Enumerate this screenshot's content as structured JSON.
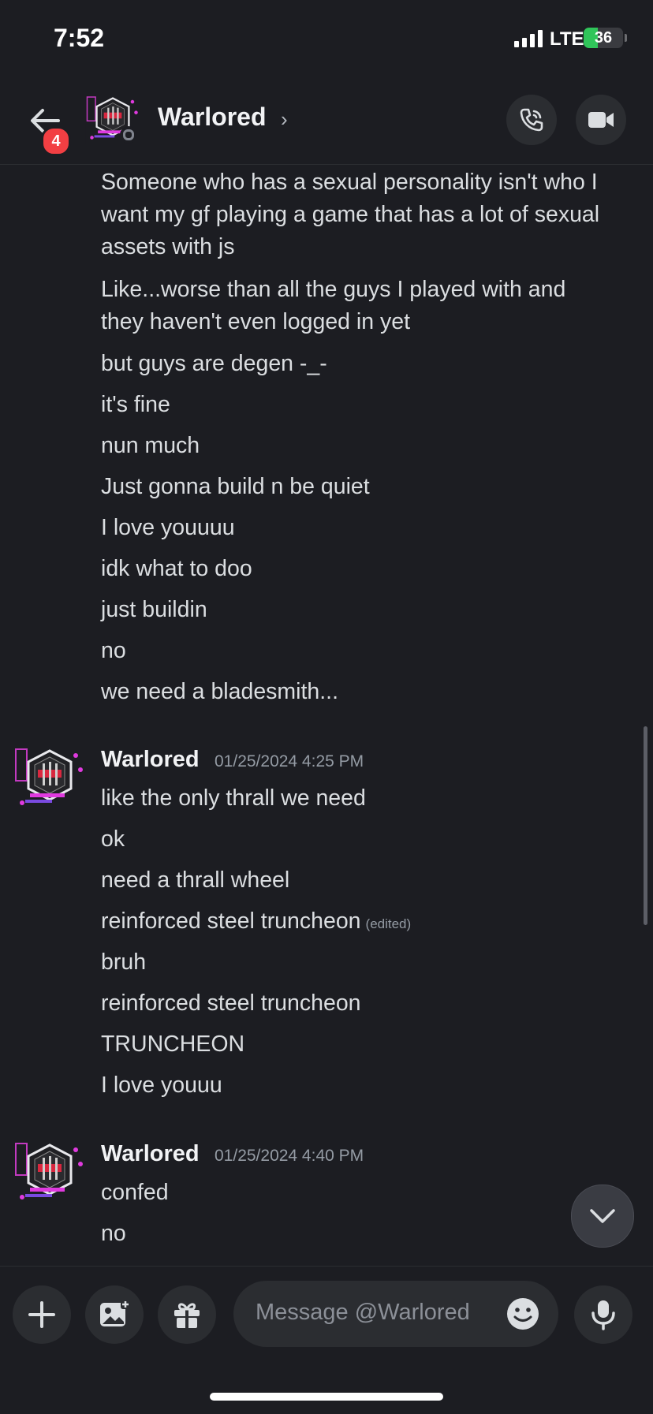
{
  "status_bar": {
    "time": "7:52",
    "network": "LTE",
    "battery": "36",
    "battery_level_percent": 36
  },
  "header": {
    "notification_count": "4",
    "name": "Warlored"
  },
  "messages": {
    "continued_lines": [
      "Someone who has a sexual personality isn't who I",
      "want my gf playing a game that has a lot of sexual",
      "assets with js",
      "Like...worse than all the guys I played with and",
      "they haven't even logged in yet",
      "but guys are degen -_-",
      "it's fine",
      "nun much",
      "Just gonna build n be quiet",
      "I love youuuu",
      "idk what to doo",
      "just buildin",
      "no",
      "we need a bladesmith..."
    ],
    "group1": {
      "author": "Warlored",
      "timestamp": "01/25/2024 4:25 PM",
      "lines": [
        "like the only thrall we need",
        "ok",
        "need a thrall wheel",
        "reinforced steel truncheon",
        "bruh",
        "reinforced steel truncheon",
        "TRUNCHEON",
        "I love youuu"
      ],
      "edited_label": "(edited)"
    },
    "group2": {
      "author": "Warlored",
      "timestamp": "01/25/2024 4:40 PM",
      "lines": [
        "confed",
        "no"
      ]
    }
  },
  "composer": {
    "placeholder": "Message @Warlored"
  },
  "icons": {
    "back": "arrow-left-icon",
    "call": "phone-icon",
    "video": "video-camera-icon",
    "add": "plus-icon",
    "image": "image-icon",
    "gift": "gift-icon",
    "emoji": "emoji-icon",
    "mic": "microphone-icon",
    "jump": "chevron-down-icon"
  },
  "colors": {
    "background": "#1c1d22",
    "badge": "#f23f43",
    "battery": "#30c55a"
  }
}
